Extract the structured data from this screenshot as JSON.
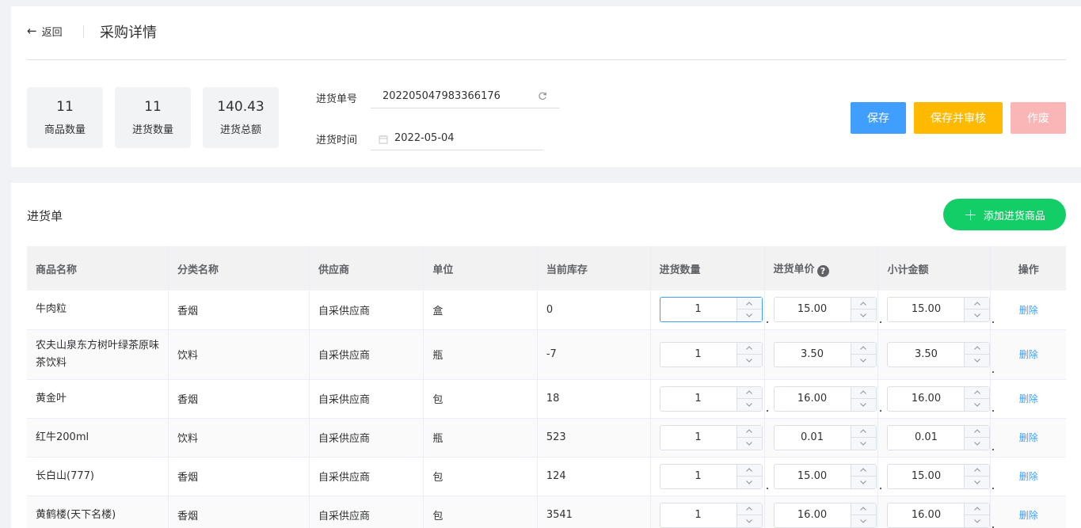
{
  "header": {
    "back_label": "返回",
    "title": "采购详情"
  },
  "stats": [
    {
      "value": "11",
      "label": "商品数量"
    },
    {
      "value": "11",
      "label": "进货数量"
    },
    {
      "value": "140.43",
      "label": "进货总额"
    }
  ],
  "form": {
    "order_no_label": "进货单号",
    "order_no_value": "202205047983366176",
    "time_label": "进货时间",
    "time_value": "2022-05-04"
  },
  "actions": {
    "save": "保存",
    "save_audit": "保存并审核",
    "void": "作废"
  },
  "section": {
    "title": "进货单",
    "add_button": "添加进货商品"
  },
  "table": {
    "headers": [
      "商品名称",
      "分类名称",
      "供应商",
      "单位",
      "当前库存",
      "进货数量",
      "进货单价",
      "小计金额",
      "操作"
    ],
    "delete_label": "删除",
    "rows": [
      {
        "name": "牛肉粒",
        "category": "香烟",
        "supplier": "自采供应商",
        "unit": "盒",
        "stock": "0",
        "qty": "1",
        "price": "15.00",
        "subtotal": "15.00"
      },
      {
        "name": "农夫山泉东方树叶绿茶原味茶饮料",
        "category": "饮料",
        "supplier": "自采供应商",
        "unit": "瓶",
        "stock": "-7",
        "qty": "1",
        "price": "3.50",
        "subtotal": "3.50"
      },
      {
        "name": "黄金叶",
        "category": "香烟",
        "supplier": "自采供应商",
        "unit": "包",
        "stock": "18",
        "qty": "1",
        "price": "16.00",
        "subtotal": "16.00"
      },
      {
        "name": "红牛200ml",
        "category": "饮料",
        "supplier": "自采供应商",
        "unit": "瓶",
        "stock": "523",
        "qty": "1",
        "price": "0.01",
        "subtotal": "0.01"
      },
      {
        "name": "长白山(777)",
        "category": "香烟",
        "supplier": "自采供应商",
        "unit": "包",
        "stock": "124",
        "qty": "1",
        "price": "15.00",
        "subtotal": "15.00"
      },
      {
        "name": "黄鹤楼(天下名楼)",
        "category": "香烟",
        "supplier": "自采供应商",
        "unit": "包",
        "stock": "3541",
        "qty": "1",
        "price": "16.00",
        "subtotal": "16.00"
      }
    ]
  },
  "colors": {
    "primary": "#409eff",
    "warning": "#ffba00",
    "danger_light": "#fab6b6",
    "success": "#13ce66"
  }
}
